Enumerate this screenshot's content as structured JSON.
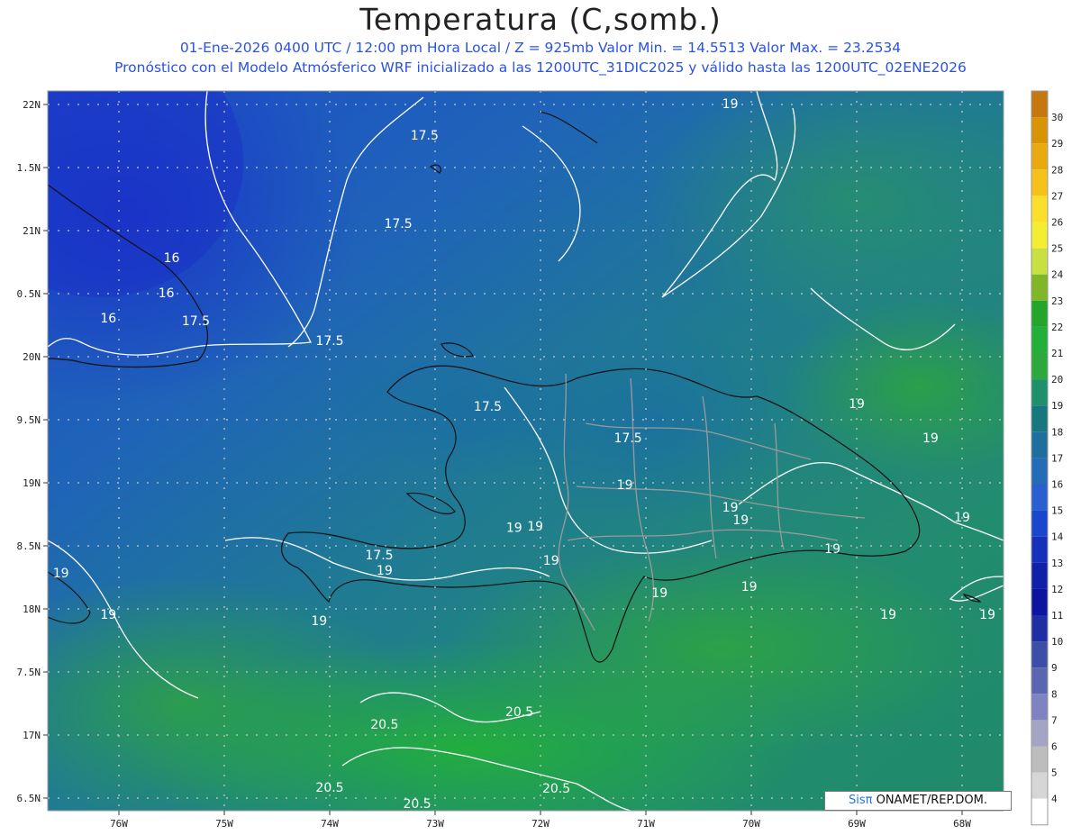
{
  "header": {
    "title": "Temperatura (C,somb.)",
    "line1": "01-Ene-2026  0400 UTC / 12:00 pm Hora Local / Z = 925mb   Valor Min. = 14.5513  Valor Max. = 23.2534",
    "line2": "Pronóstico con el Modelo Atmósferico WRF inicializado a las 1200UTC_31DIC2025 y válido hasta las  1200UTC_02ENE2026"
  },
  "map": {
    "lon_labels": [
      "76W",
      "75W",
      "74W",
      "73W",
      "72W",
      "71W",
      "70W",
      "69W",
      "68W"
    ],
    "lat_labels": [
      "22N",
      "1.5N",
      "21N",
      "0.5N",
      "20N",
      "9.5N",
      "19N",
      "8.5N",
      "18N",
      "7.5N",
      "17N",
      "6.5N"
    ],
    "contour_labels": [
      {
        "text": "17.5",
        "lon": -73.1,
        "lat": 21.75
      },
      {
        "text": "17.5",
        "lon": -73.35,
        "lat": 21.05
      },
      {
        "text": "16",
        "lon": -75.5,
        "lat": 20.78
      },
      {
        "text": "16",
        "lon": -75.55,
        "lat": 20.5
      },
      {
        "text": "16",
        "lon": -76.1,
        "lat": 20.3
      },
      {
        "text": "17.5",
        "lon": -75.27,
        "lat": 20.28
      },
      {
        "text": "17.5",
        "lon": -74.0,
        "lat": 20.12
      },
      {
        "text": "17.5",
        "lon": -72.5,
        "lat": 19.6
      },
      {
        "text": "17.5",
        "lon": -71.17,
        "lat": 19.35
      },
      {
        "text": "19",
        "lon": -69.0,
        "lat": 19.62
      },
      {
        "text": "19",
        "lon": -68.3,
        "lat": 19.35
      },
      {
        "text": "19",
        "lon": -71.2,
        "lat": 18.98
      },
      {
        "text": "19",
        "lon": -70.2,
        "lat": 18.8
      },
      {
        "text": "19",
        "lon": -70.1,
        "lat": 18.7
      },
      {
        "text": "19",
        "lon": -68.0,
        "lat": 18.72
      },
      {
        "text": "19",
        "lon": -72.25,
        "lat": 18.64
      },
      {
        "text": "19",
        "lon": -72.05,
        "lat": 18.65
      },
      {
        "text": "19",
        "lon": -69.23,
        "lat": 18.47
      },
      {
        "text": "19",
        "lon": -71.9,
        "lat": 18.38
      },
      {
        "text": "19",
        "lon": -73.48,
        "lat": 18.3
      },
      {
        "text": "19",
        "lon": -70.02,
        "lat": 18.17
      },
      {
        "text": "19",
        "lon": -70.87,
        "lat": 18.12
      },
      {
        "text": "19",
        "lon": -76.55,
        "lat": 18.28
      },
      {
        "text": "19",
        "lon": -76.1,
        "lat": 17.95
      },
      {
        "text": "19",
        "lon": -74.1,
        "lat": 17.9
      },
      {
        "text": "19",
        "lon": -68.7,
        "lat": 17.95
      },
      {
        "text": "19",
        "lon": -67.76,
        "lat": 17.95
      },
      {
        "text": "19",
        "lon": -70.2,
        "lat": 22.0
      },
      {
        "text": "17.5",
        "lon": -73.53,
        "lat": 18.42
      },
      {
        "text": "20.5",
        "lon": -73.48,
        "lat": 17.08
      },
      {
        "text": "20.5",
        "lon": -72.2,
        "lat": 17.18
      },
      {
        "text": "20.5",
        "lon": -74.0,
        "lat": 16.58
      },
      {
        "text": "20.5",
        "lon": -73.17,
        "lat": 16.45
      },
      {
        "text": "20.5",
        "lon": -71.85,
        "lat": 16.57
      }
    ]
  },
  "colorbar": {
    "ticks": [
      "30",
      "29",
      "28",
      "27",
      "26",
      "25",
      "24",
      "23",
      "22",
      "21",
      "20",
      "19",
      "18",
      "17",
      "16",
      "15",
      "14",
      "13",
      "12",
      "11",
      "10",
      "9",
      "8",
      "7",
      "6",
      "5",
      "4"
    ],
    "colors": [
      "#c4780f",
      "#d99405",
      "#e8aa10",
      "#f5c21b",
      "#fae02d",
      "#f3ee35",
      "#c9e043",
      "#7fb728",
      "#24a52c",
      "#22b03a",
      "#2ca83c",
      "#1f8f6c",
      "#17777f",
      "#1e6f9e",
      "#246bb8",
      "#2a5fd0",
      "#1a46cc",
      "#1530bb",
      "#1020a9",
      "#0c14a0",
      "#1e2ea4",
      "#3c4ea8",
      "#5b66b0",
      "#7f83bf",
      "#a4a4c4",
      "#bdbdbd",
      "#d6d6d6",
      "#ffffff"
    ]
  },
  "footer": {
    "logo": "Sisπ",
    "credit": " ONAMET/REP.DOM."
  }
}
